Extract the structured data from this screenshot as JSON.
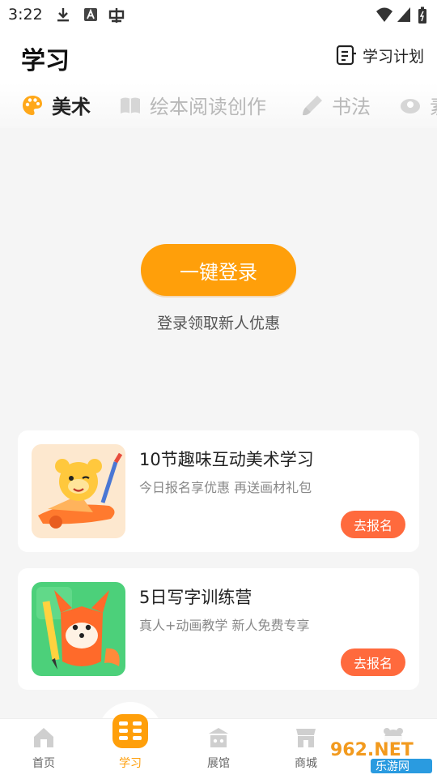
{
  "status_bar": {
    "time": "3:22"
  },
  "header": {
    "title": "学习",
    "plan_label": "学习计划"
  },
  "tabs": [
    {
      "label": "美术",
      "icon": "palette-icon",
      "active": true
    },
    {
      "label": "绘本阅读创作",
      "icon": "book-icon",
      "active": false
    },
    {
      "label": "书法",
      "icon": "brush-icon",
      "active": false
    },
    {
      "label": "素",
      "icon": "more-tab-icon",
      "active": false
    }
  ],
  "login": {
    "button_label": "一键登录",
    "tip": "登录领取新人优惠"
  },
  "courses": [
    {
      "title": "10节趣味互动美术学习",
      "subtitle": "今日报名享优惠 再送画材礼包",
      "action": "去报名"
    },
    {
      "title": "5日写字训练营",
      "subtitle": "真人+动画教学 新人免费专享",
      "action": "去报名"
    }
  ],
  "bottom_nav": [
    {
      "label": "首页",
      "icon": "home-icon",
      "active": false
    },
    {
      "label": "学习",
      "icon": "study-icon",
      "active": true
    },
    {
      "label": "展馆",
      "icon": "gallery-icon",
      "active": false
    },
    {
      "label": "商城",
      "icon": "store-icon",
      "active": false
    },
    {
      "label": "",
      "icon": "profile-icon",
      "active": false
    }
  ],
  "watermark": {
    "text_top": "962.NET",
    "text_bottom": "乐游网"
  },
  "colors": {
    "accent": "#ff9f0a",
    "enroll": "#ff6a3d",
    "background": "#f5f5f5"
  }
}
